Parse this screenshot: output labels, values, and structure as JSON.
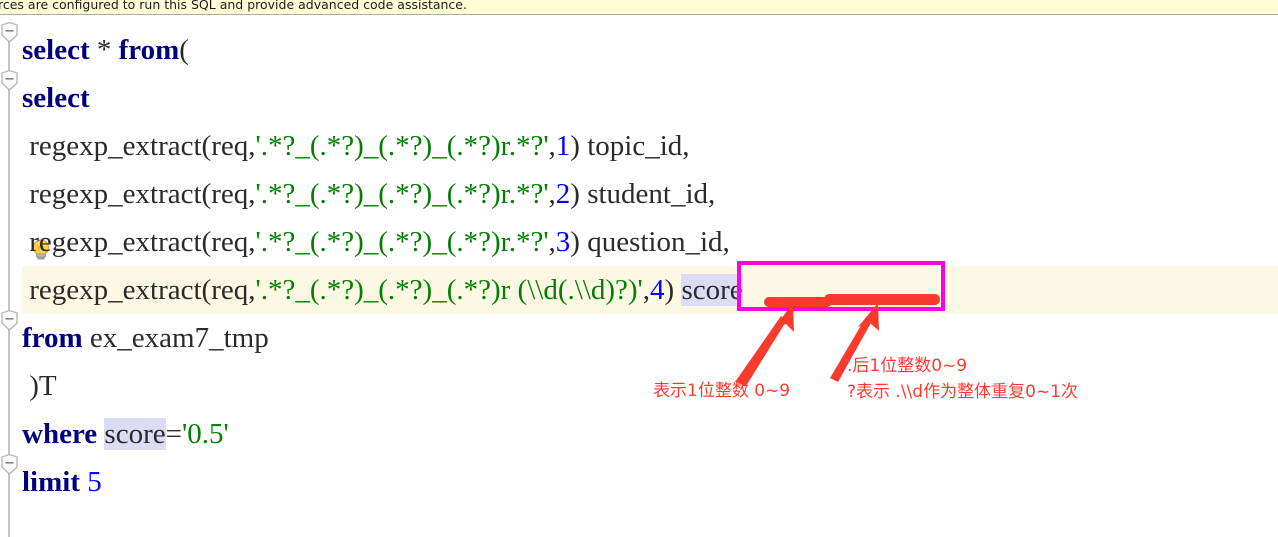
{
  "banner": {
    "text": "rces are configured to run this SQL and provide advanced code assistance.",
    "background": "#fffcd6"
  },
  "editor": {
    "background": "#ffffff",
    "current_line_background": "#fdf8e3",
    "identifier_highlight": "#dcdcf7",
    "colors": {
      "keyword": "#000080",
      "string": "#008000",
      "number": "#0000ff",
      "plain": "#2b2b2b"
    },
    "gutter": {
      "fold_icons": [
        "fold-collapse-icon",
        "fold-collapse-icon",
        "fold-collapse-icon",
        "fold-collapse-icon"
      ],
      "intention_icon": "lightbulb-icon"
    },
    "lines": [
      {
        "id": "line-1",
        "tokens": [
          {
            "t": "select",
            "c": "kw"
          },
          {
            "t": " ",
            "c": "pln"
          },
          {
            "t": "*",
            "c": "pln"
          },
          {
            "t": " ",
            "c": "pln"
          },
          {
            "t": "from",
            "c": "kw"
          },
          {
            "t": "(",
            "c": "pln"
          }
        ]
      },
      {
        "id": "line-2",
        "tokens": [
          {
            "t": "select",
            "c": "kw"
          }
        ]
      },
      {
        "id": "line-3",
        "tokens": [
          {
            "t": " regexp_extract(req,",
            "c": "pln"
          },
          {
            "t": "'.*?_(.*?)_(.*?)_(.*?)r.*?'",
            "c": "str"
          },
          {
            "t": ",",
            "c": "pln"
          },
          {
            "t": "1",
            "c": "num"
          },
          {
            "t": ") topic_id,",
            "c": "pln"
          }
        ]
      },
      {
        "id": "line-4",
        "tokens": [
          {
            "t": " regexp_extract(req,",
            "c": "pln"
          },
          {
            "t": "'.*?_(.*?)_(.*?)_(.*?)r.*?'",
            "c": "str"
          },
          {
            "t": ",",
            "c": "pln"
          },
          {
            "t": "2",
            "c": "num"
          },
          {
            "t": ") student_id,",
            "c": "pln"
          }
        ]
      },
      {
        "id": "line-5",
        "tokens": [
          {
            "t": " regexp_extract(req,",
            "c": "pln"
          },
          {
            "t": "'.*?_(.*?)_(.*?)_(.*?)r.*?'",
            "c": "str"
          },
          {
            "t": ",",
            "c": "pln"
          },
          {
            "t": "3",
            "c": "num"
          },
          {
            "t": ") question_id,",
            "c": "pln"
          }
        ]
      },
      {
        "id": "line-6",
        "current": true,
        "tokens": [
          {
            "t": " regexp_extract(req,",
            "c": "pln"
          },
          {
            "t": "'.*?_(.*?)_(.*?)_(.*?)r (\\\\d(.\\\\d)?)'",
            "c": "str"
          },
          {
            "t": ",",
            "c": "pln"
          },
          {
            "t": "4",
            "c": "num"
          },
          {
            "t": ") ",
            "c": "pln"
          },
          {
            "t": "score",
            "c": "pln ident-hl"
          }
        ]
      },
      {
        "id": "line-7",
        "tokens": [
          {
            "t": "from",
            "c": "kw"
          },
          {
            "t": " ex_exam7_tmp",
            "c": "pln"
          }
        ]
      },
      {
        "id": "line-8",
        "tokens": [
          {
            "t": " )T",
            "c": "pln"
          }
        ]
      },
      {
        "id": "line-9",
        "tokens": [
          {
            "t": "where",
            "c": "kw"
          },
          {
            "t": " ",
            "c": "pln"
          },
          {
            "t": "score",
            "c": "pln ident-hl"
          },
          {
            "t": "=",
            "c": "pln"
          },
          {
            "t": "'0.5'",
            "c": "str"
          }
        ]
      },
      {
        "id": "line-10",
        "tokens": [
          {
            "t": "limit",
            "c": "kw"
          },
          {
            "t": " ",
            "c": "pln"
          },
          {
            "t": "5",
            "c": "num"
          }
        ]
      }
    ]
  },
  "annotations": {
    "box_color": "#ff00e6",
    "marker_color": "#ff3b30",
    "boxed_expression": "(\\\\d(.\\\\d)?)",
    "left_note": "表示1位整数 0~9",
    "right_note_line1": ".后1位整数0~9",
    "right_note_line2": "?表示 .\\\\d作为整体重复0~1次"
  }
}
